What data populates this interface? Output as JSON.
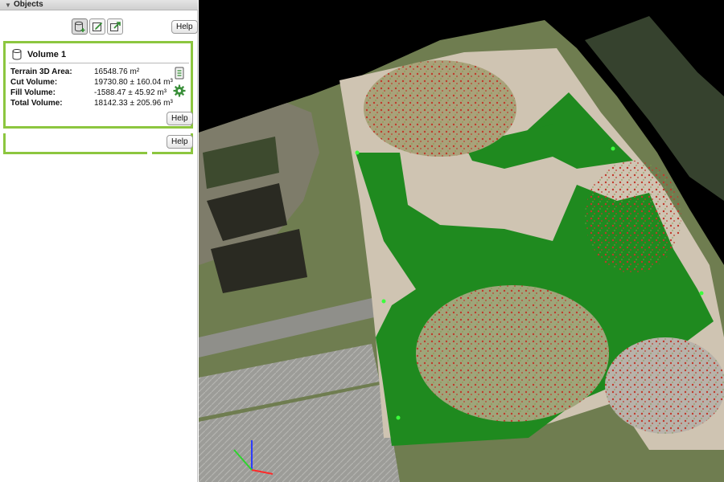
{
  "panel": {
    "title": "Objects",
    "toolbar": {
      "icons": [
        "new-volume-icon",
        "edit-icon",
        "export-icon"
      ],
      "help_label": "Help"
    },
    "volume": {
      "name": "Volume 1",
      "stats": [
        {
          "label": "Terrain 3D Area:",
          "value": "16548.76  m²"
        },
        {
          "label": "Cut Volume:",
          "value": "19730.80 ± 160.04  m³"
        },
        {
          "label": "Fill Volume:",
          "value": "-1588.47 ± 45.92  m³"
        },
        {
          "label": "Total Volume:",
          "value": "18142.33 ± 205.96  m³"
        }
      ],
      "help_label": "Help"
    },
    "second_help_label": "Help"
  },
  "viewport": {
    "colors": {
      "sky": "#000000",
      "fill_region": "#1f8a1f",
      "cut_points": "#c0392b",
      "terrain": "#cfc4b2",
      "vegetation": "#5f7f3a",
      "roof": "#9a9a96"
    }
  }
}
